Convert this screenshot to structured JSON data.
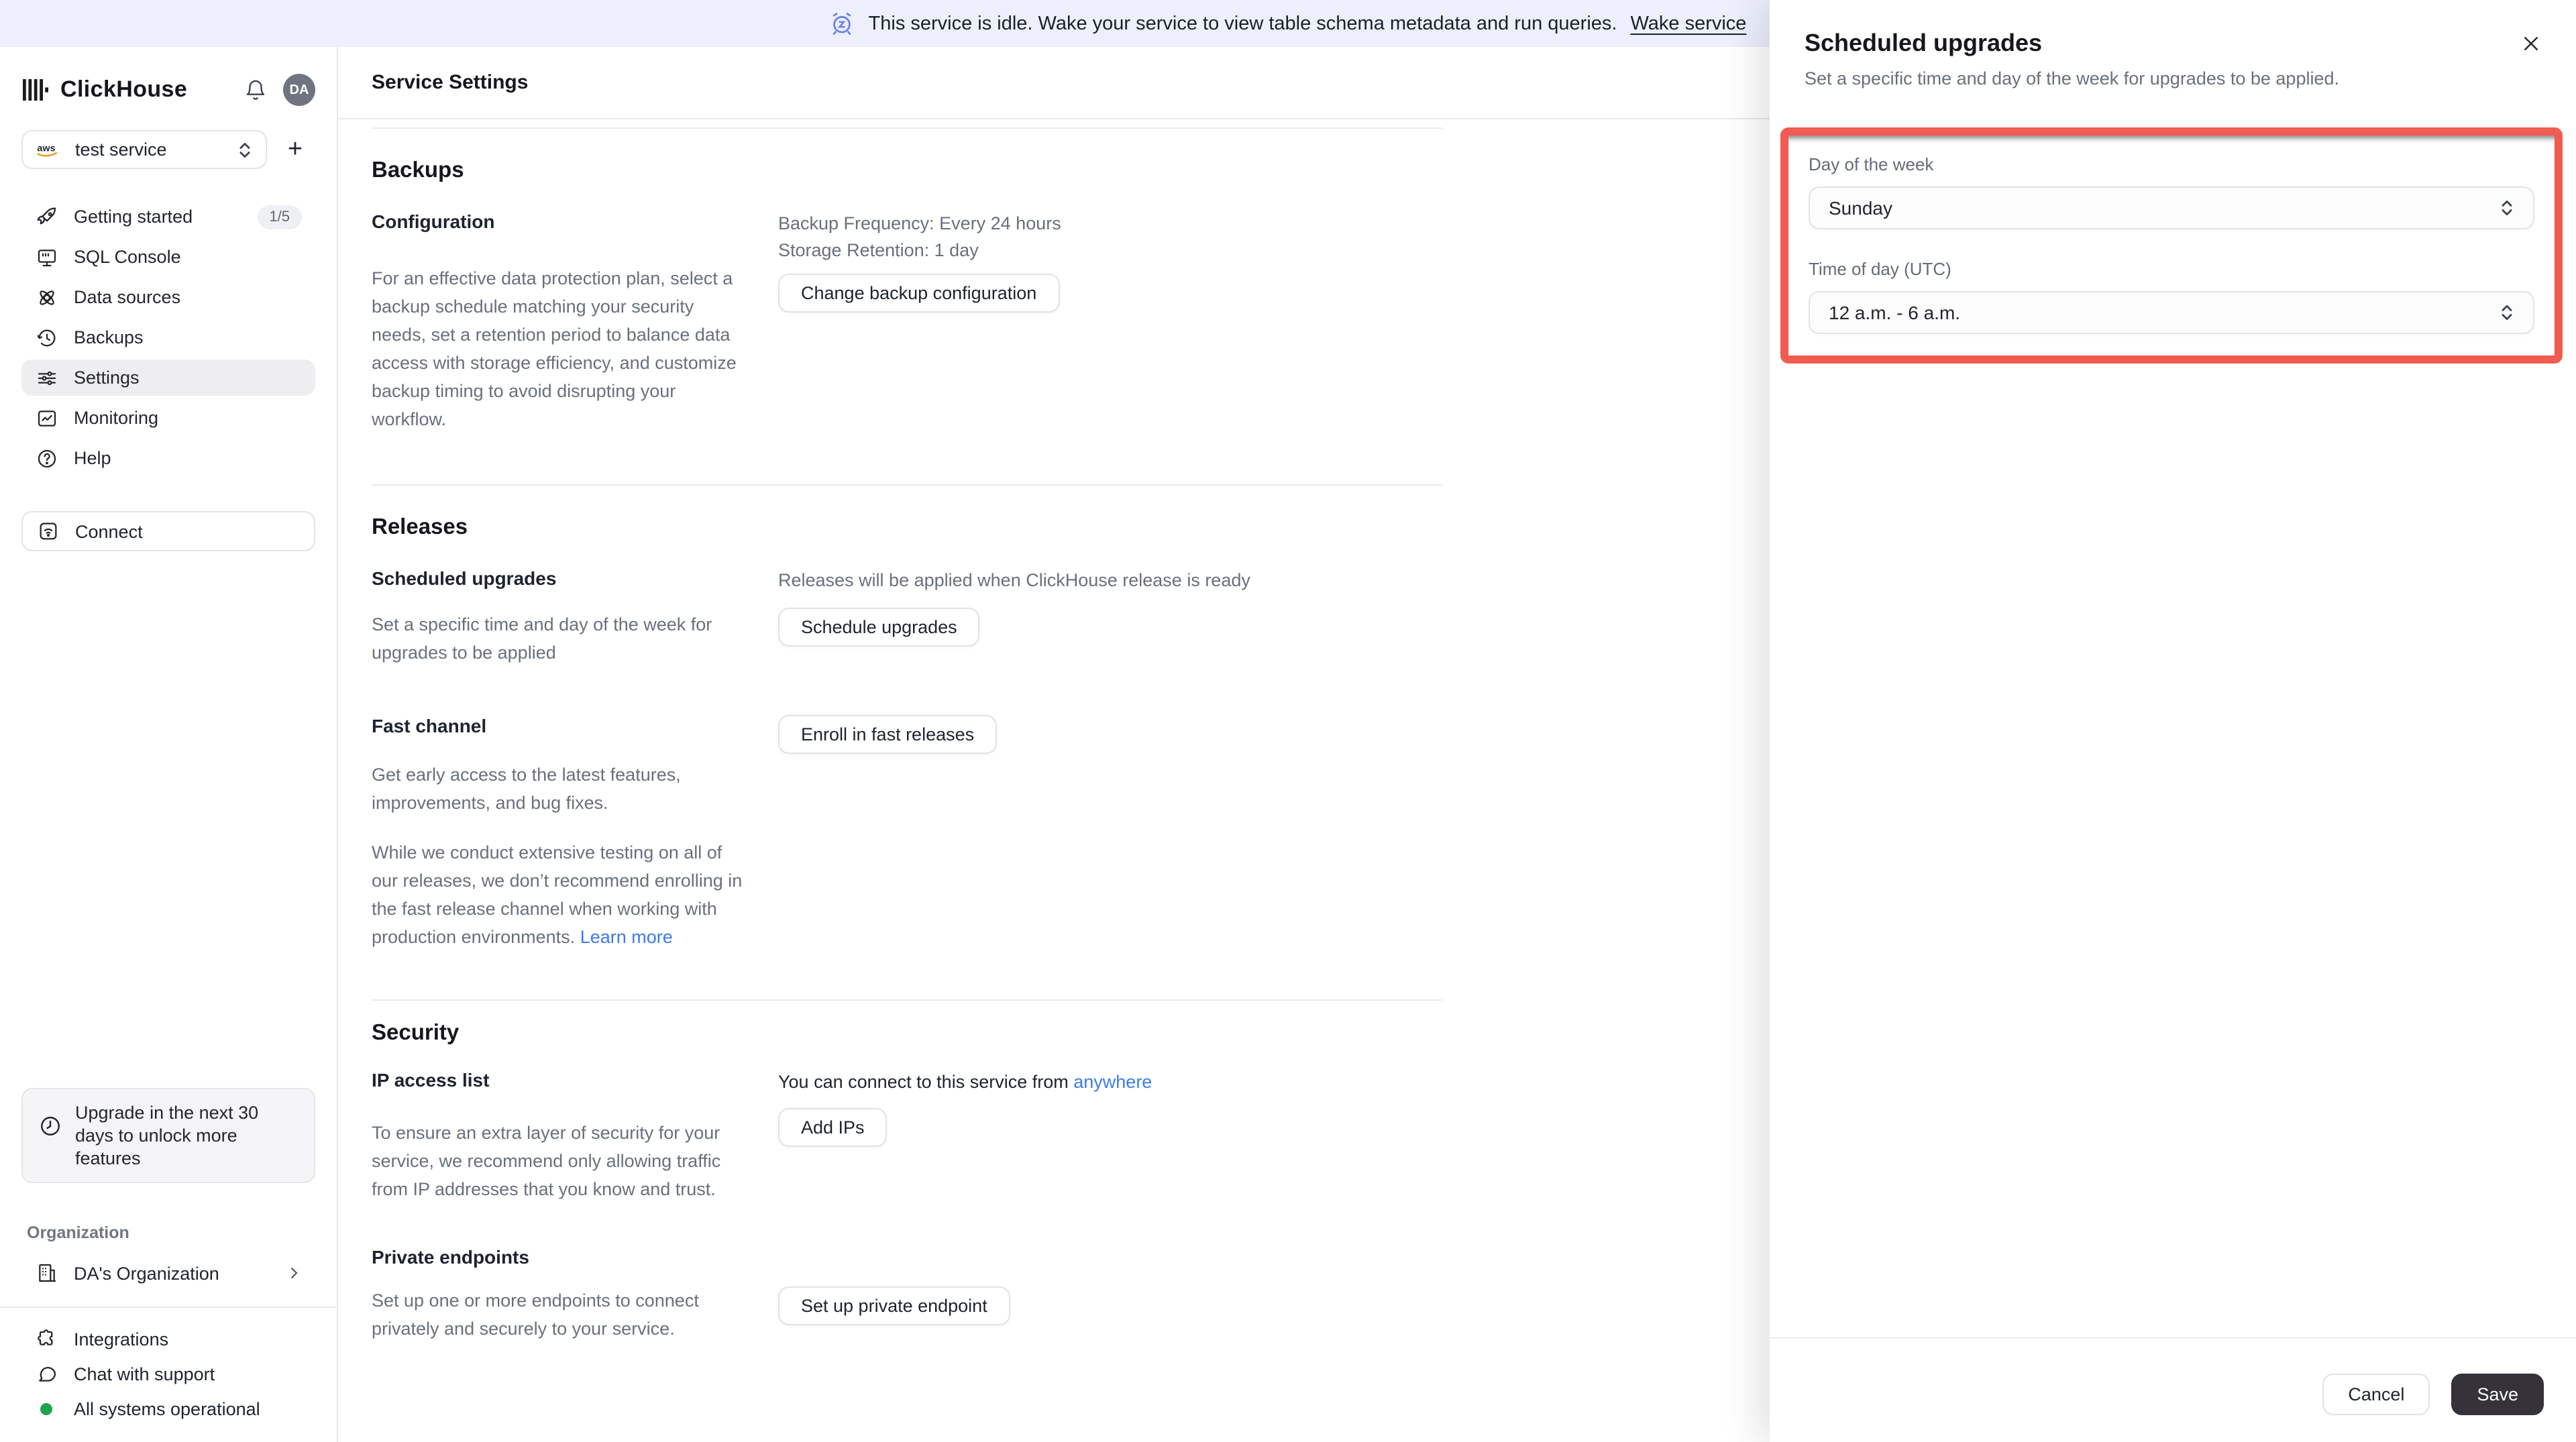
{
  "banner": {
    "icon": "alarm-clock-icon",
    "text": "This service is idle. Wake your service to view table schema metadata and run queries.",
    "link_label": "Wake service"
  },
  "sidebar": {
    "logo_text": "ClickHouse",
    "avatar_initials": "DA",
    "service_selector": {
      "value": "test service",
      "provider_icon": "aws-icon"
    },
    "add_service_label": "+",
    "nav": [
      {
        "label": "Getting started",
        "icon": "rocket-icon",
        "badge": "1/5"
      },
      {
        "label": "SQL Console",
        "icon": "monitor-icon"
      },
      {
        "label": "Data sources",
        "icon": "orbit-icon"
      },
      {
        "label": "Backups",
        "icon": "history-icon"
      },
      {
        "label": "Settings",
        "icon": "sliders-icon",
        "active": true
      },
      {
        "label": "Monitoring",
        "icon": "chart-icon"
      },
      {
        "label": "Help",
        "icon": "help-circle-icon"
      }
    ],
    "connect_label": "Connect",
    "upgrade_notice": "Upgrade in the next 30 days to unlock more features",
    "organization_label": "Organization",
    "organization_name": "DA's Organization",
    "footer_items": [
      {
        "label": "Integrations",
        "icon": "puzzle-icon"
      },
      {
        "label": "Chat with support",
        "icon": "chat-icon"
      },
      {
        "label": "All systems operational",
        "icon": "status-dot",
        "status_color": "#1ea54c"
      }
    ]
  },
  "main": {
    "page_title": "Service Settings",
    "backups": {
      "heading": "Backups",
      "config_heading": "Configuration",
      "meta_line1": "Backup Frequency: Every 24 hours",
      "meta_line2": "Storage Retention: 1 day",
      "description": "For an effective data protection plan, select a backup schedule matching your security needs, set a retention period to balance data access with storage efficiency, and customize backup timing to avoid disrupting your workflow.",
      "button_label": "Change backup configuration"
    },
    "releases": {
      "heading": "Releases",
      "scheduled": {
        "heading": "Scheduled upgrades",
        "description": "Set a specific time and day of the week for upgrades to be applied",
        "note": "Releases will be applied when ClickHouse release is ready",
        "button_label": "Schedule upgrades"
      },
      "fast": {
        "heading": "Fast channel",
        "button_label": "Enroll in fast releases",
        "paragraph1": "Get early access to the latest features, improvements, and bug fixes.",
        "paragraph2": "While we conduct extensive testing on all of our releases, we don’t recommend enrolling in the fast release channel when working with production environments. ",
        "link_label": "Learn more"
      }
    },
    "security": {
      "heading": "Security",
      "ip_access": {
        "heading": "IP access list",
        "note_prefix": "You can connect to this service from ",
        "note_link": "anywhere",
        "description": "To ensure an extra layer of security for your service, we recommend only allowing traffic from IP addresses that you know and trust.",
        "button_label": "Add IPs"
      },
      "private_endpoints": {
        "heading": "Private endpoints",
        "description": "Set up one or more endpoints to connect privately and securely to your service.",
        "button_label": "Set up private endpoint"
      }
    }
  },
  "panel": {
    "title": "Scheduled upgrades",
    "subtitle": "Set a specific time and day of the week for upgrades to be applied.",
    "close_icon": "close-icon",
    "fields": [
      {
        "label": "Day of the week",
        "value": "Sunday"
      },
      {
        "label": "Time of day (UTC)",
        "value": "12 a.m. - 6 a.m."
      }
    ],
    "cancel_label": "Cancel",
    "save_label": "Save",
    "highlight_color": "#f15b50"
  },
  "colors": {
    "banner_bg": "#edf0fc",
    "banner_icon_blue": "#6c83e8",
    "link_blue": "#3b7af0",
    "status_green": "#1ea54c",
    "save_button_bg": "#35323a",
    "annotation_red": "#f15b50"
  }
}
